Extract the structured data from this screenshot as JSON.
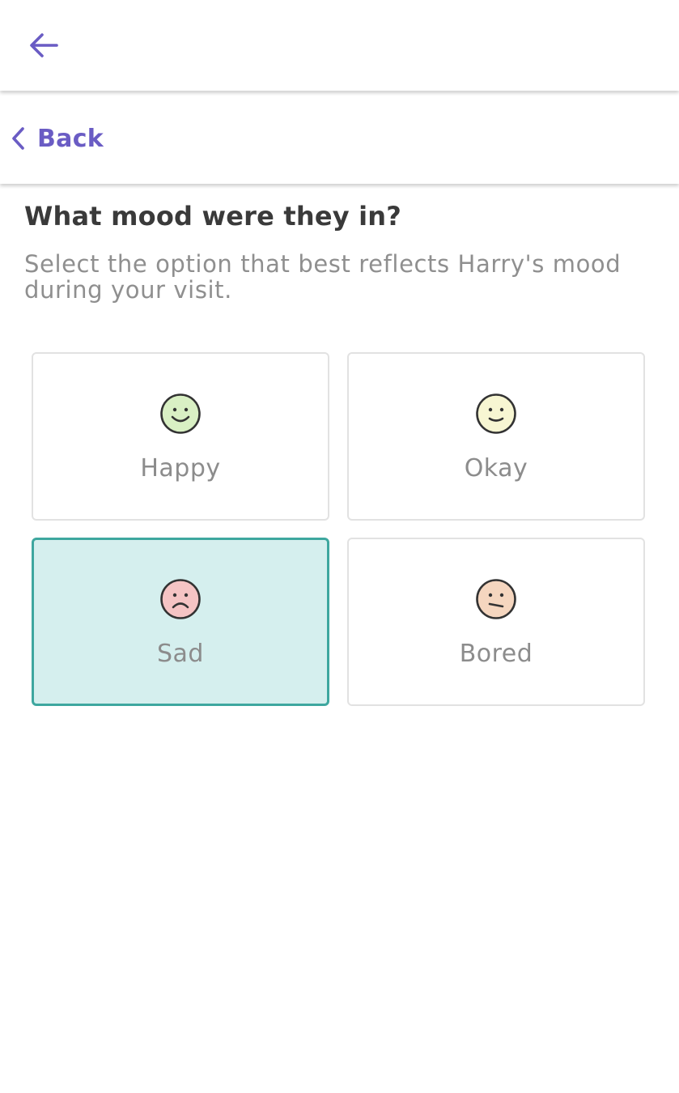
{
  "header": {
    "nav_icon": "arrow-left-icon"
  },
  "back_bar": {
    "icon": "chevron-left-icon",
    "label": "Back"
  },
  "question": {
    "title": "What mood were they in?",
    "subtitle": "Select the option that best reflects Harry's mood during your visit."
  },
  "moods": [
    {
      "label": "Happy",
      "icon": "happy-face-icon",
      "color": "#d9f0c4",
      "selected": false
    },
    {
      "label": "Okay",
      "icon": "neutral-smile-face-icon",
      "color": "#f7f6d2",
      "selected": false
    },
    {
      "label": "Sad",
      "icon": "sad-face-icon",
      "color": "#f5c4c4",
      "selected": true
    },
    {
      "label": "Bored",
      "icon": "bored-face-icon",
      "color": "#f5d6bf",
      "selected": false
    }
  ],
  "colors": {
    "accent": "#6a5cc4",
    "selected_border": "#3ea79f",
    "selected_fill": "#d5efee"
  }
}
